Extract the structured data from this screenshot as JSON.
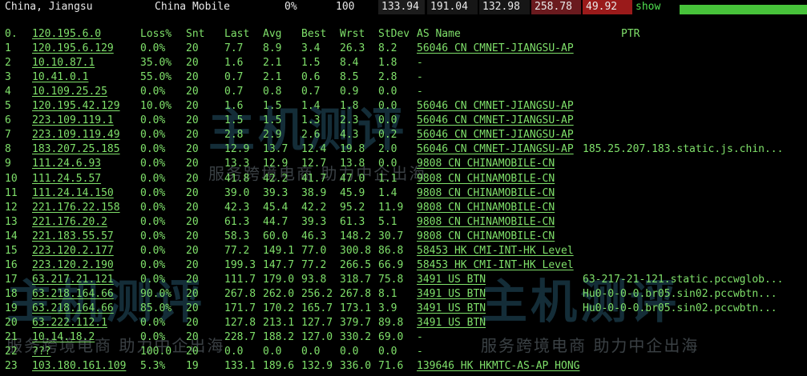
{
  "summary": {
    "location": "China, Jiangsu",
    "isp": "China Mobile",
    "loss": "0%",
    "sent": "100",
    "values": [
      {
        "text": "133.94",
        "bg": "#1c1c1c"
      },
      {
        "text": "191.04",
        "bg": "#161616"
      },
      {
        "text": "132.98",
        "bg": "#161616"
      },
      {
        "text": "258.78",
        "bg": "#6a1a1e"
      },
      {
        "text": "49.92",
        "bg": "#9a1a1a"
      }
    ],
    "show_link": "show",
    "accent": "#47c23a"
  },
  "headers": [
    "0.",
    "120.195.6.0",
    "Loss%",
    "Snt",
    "Last",
    "Avg",
    "Best",
    "Wrst",
    "StDev",
    "AS Name",
    "PTR"
  ],
  "rows": [
    [
      "1",
      "120.195.6.129",
      "0.0%",
      "20",
      "7.7",
      "8.9",
      "3.4",
      "26.3",
      "8.2",
      "56046 CN CMNET-JIANGSU-AP",
      ""
    ],
    [
      "2",
      "10.10.87.1",
      "35.0%",
      "20",
      "1.6",
      "2.1",
      "1.5",
      "8.4",
      "1.8",
      "-",
      ""
    ],
    [
      "3",
      "10.41.0.1",
      "55.0%",
      "20",
      "0.7",
      "2.1",
      "0.6",
      "8.5",
      "2.8",
      "-",
      ""
    ],
    [
      "4",
      "10.109.25.25",
      "0.0%",
      "20",
      "0.7",
      "0.8",
      "0.7",
      "0.9",
      "0.0",
      "-",
      ""
    ],
    [
      "5",
      "120.195.42.129",
      "10.0%",
      "20",
      "1.6",
      "1.5",
      "1.4",
      "1.8",
      "0.0",
      "56046 CN CMNET-JIANGSU-AP",
      ""
    ],
    [
      "6",
      "223.109.119.1",
      "0.0%",
      "20",
      "1.5",
      "1.5",
      "1.3",
      "2.3",
      "0.0",
      "56046 CN CMNET-JIANGSU-AP",
      ""
    ],
    [
      "7",
      "223.109.119.49",
      "0.0%",
      "20",
      "2.8",
      "2.9",
      "2.6",
      "4.3",
      "0.2",
      "56046 CN CMNET-JIANGSU-AP",
      ""
    ],
    [
      "8",
      "183.207.25.185",
      "0.0%",
      "20",
      "12.9",
      "13.7",
      "12.4",
      "19.8",
      "2.0",
      "56046 CN CMNET-JIANGSU-AP",
      "185.25.207.183.static.js.chin..."
    ],
    [
      "9",
      "111.24.6.93",
      "0.0%",
      "20",
      "13.3",
      "12.9",
      "12.7",
      "13.8",
      "0.0",
      "9808 CN CHINAMOBILE-CN",
      ""
    ],
    [
      "10",
      "111.24.5.57",
      "0.0%",
      "20",
      "41.8",
      "42.2",
      "41.7",
      "47.0",
      "1.1",
      "9808 CN CHINAMOBILE-CN",
      ""
    ],
    [
      "11",
      "111.24.14.150",
      "0.0%",
      "20",
      "39.0",
      "39.3",
      "38.9",
      "45.9",
      "1.4",
      "9808 CN CHINAMOBILE-CN",
      ""
    ],
    [
      "12",
      "221.176.22.158",
      "0.0%",
      "20",
      "42.3",
      "45.4",
      "42.2",
      "95.2",
      "11.9",
      "9808 CN CHINAMOBILE-CN",
      ""
    ],
    [
      "13",
      "221.176.20.2",
      "0.0%",
      "20",
      "61.3",
      "44.7",
      "39.3",
      "61.3",
      "5.1",
      "9808 CN CHINAMOBILE-CN",
      ""
    ],
    [
      "14",
      "221.183.55.57",
      "0.0%",
      "20",
      "58.3",
      "60.0",
      "46.3",
      "148.2",
      "30.7",
      "9808 CN CHINAMOBILE-CN",
      ""
    ],
    [
      "15",
      "223.120.2.177",
      "0.0%",
      "20",
      "77.2",
      "149.1",
      "77.0",
      "300.8",
      "86.8",
      "58453 HK CMI-INT-HK Level",
      ""
    ],
    [
      "16",
      "223.120.2.190",
      "0.0%",
      "20",
      "199.3",
      "147.7",
      "77.2",
      "266.5",
      "66.9",
      "58453 HK CMI-INT-HK Level",
      ""
    ],
    [
      "17",
      "63.217.21.121",
      "0.0%",
      "20",
      "111.7",
      "179.0",
      "93.8",
      "318.7",
      "75.8",
      "3491 US BTN",
      "63-217-21-121.static.pccwglob..."
    ],
    [
      "18",
      "63.218.164.66",
      "90.0%",
      "20",
      "267.8",
      "262.0",
      "256.2",
      "267.8",
      "8.1",
      "3491 US BTN",
      "Hu0-0-0-0.br05.sin02.pccwbtn..."
    ],
    [
      "19",
      "63.218.164.66",
      "85.0%",
      "20",
      "171.7",
      "170.2",
      "165.7",
      "173.1",
      "3.9",
      "3491 US BTN",
      "Hu0-0-0-0.br05.sin02.pccwbtn..."
    ],
    [
      "20",
      "63.222.112.1",
      "0.0%",
      "20",
      "127.8",
      "213.1",
      "127.7",
      "379.7",
      "89.8",
      "3491 US BTN",
      ""
    ],
    [
      "21",
      "10.14.18.2",
      "0.0%",
      "20",
      "228.7",
      "188.2",
      "127.0",
      "330.2",
      "69.0",
      "-",
      ""
    ],
    [
      "22",
      "???",
      "100.0",
      "20",
      "0.0",
      "0.0",
      "0.0",
      "0.0",
      "0.0",
      "-",
      ""
    ],
    [
      "23",
      "103.180.161.109",
      "5.3%",
      "19",
      "133.1",
      "189.6",
      "132.9",
      "336.0",
      "71.6",
      "139646 HK HKMTC-AS-AP HONG",
      ""
    ]
  ],
  "watermarks": [
    {
      "logo": "主机测评",
      "slogan": "服务跨境电商 助力中企出海"
    },
    {
      "logo": "主机测评",
      "slogan": "服务跨境电商 助力中企出海"
    },
    {
      "logo": "主机测评",
      "slogan": "服务跨境电商 助力中企出海"
    }
  ]
}
